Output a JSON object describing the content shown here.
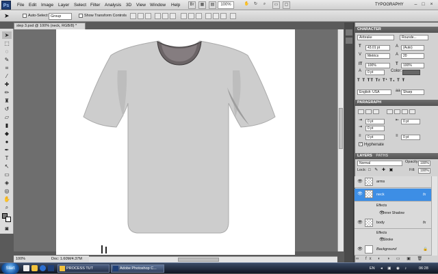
{
  "menubar": {
    "logo": "Ps",
    "items": [
      "File",
      "Edit",
      "Image",
      "Layer",
      "Select",
      "Filter",
      "Analysis",
      "3D",
      "View",
      "Window",
      "Help"
    ],
    "zoom": "100%",
    "workspace": "TYPOGRAPHY"
  },
  "options": {
    "auto_select_label": "Auto-Select:",
    "auto_select_value": "Group",
    "show_transform_label": "Show Transform Controls"
  },
  "document": {
    "tab_title": "step 3.psd @ 100% (neck, RGB/8) *",
    "zoom": "100%",
    "doc_size": "Doc: 1.60M/4.37M"
  },
  "character": {
    "title": "CHARACTER",
    "font_family": "Airbrake",
    "font_style": "Rounde...",
    "size": "43.01 pt",
    "leading": "(Auto)",
    "kerning": "Metrics",
    "tracking": "20",
    "vscale": "100%",
    "hscale": "100%",
    "baseline": "0 pt",
    "color_label": "Color:",
    "language": "English: USA",
    "antialias": "Sharp"
  },
  "paragraph": {
    "title": "PARAGRAPH",
    "indent_left": "0 pt",
    "indent_right": "0 pt",
    "first_line": "0 pt",
    "space_before": "0 pt",
    "space_after": "0 pt",
    "hyphenate": "Hyphenate"
  },
  "layers": {
    "tab1": "LAYERS",
    "tab2": "PATHS",
    "blend": "Normal",
    "opacity_label": "Opacity:",
    "opacity": "100%",
    "lock_label": "Lock:",
    "fill_label": "Fill:",
    "fill": "100%",
    "items": [
      {
        "name": "arms"
      },
      {
        "name": "neck",
        "fx": "fx"
      },
      {
        "name": "Effects"
      },
      {
        "name": "Inner Shadow"
      },
      {
        "name": "body",
        "fx": "fx"
      },
      {
        "name": "Effects"
      },
      {
        "name": "Stroke"
      },
      {
        "name": "Background"
      }
    ]
  },
  "taskbar": {
    "start": "Start",
    "task1": "PROCESS TUT",
    "task2": "Adobe Photoshop C...",
    "lang": "EN",
    "clock": "06:28"
  },
  "colors": {
    "accent": "#3d8ee5",
    "tshirt": "#cdcdcd",
    "neckband": "#6b6466"
  }
}
